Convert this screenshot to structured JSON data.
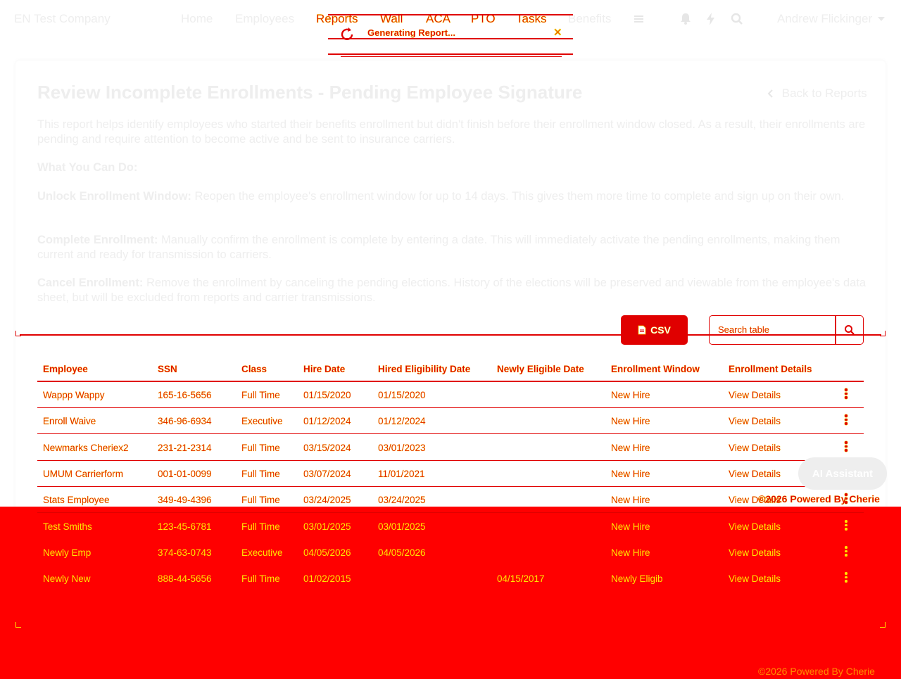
{
  "company": "EN Test Company",
  "nav": {
    "links": [
      "Home",
      "Employees",
      "Reports",
      "Wall",
      "ACA",
      "PTO",
      "Tasks",
      "Benefits"
    ],
    "menu_icon": "hamburger-icon",
    "bell_icon": "bell-icon",
    "bolt_icon": "bolt-icon",
    "search_icon": "search-icon",
    "user": "Andrew Flickinger"
  },
  "toast": {
    "message": "Generating Report...",
    "close": "✕"
  },
  "page": {
    "title": "Review Incomplete Enrollments - Pending Employee Signature",
    "back_link": "Back to Reports",
    "intro": "This report helps identify employees who started their benefits enrollment but didn't finish before their enrollment window closed. As a result, their enrollments are pending and require attention to become active and be sent to insurance carriers.",
    "what_you_can_do": "What You Can Do:",
    "unlock_title": "Unlock Enrollment Window:",
    "unlock_text": " Reopen the employee's enrollment window for up to 14 days. This gives them more time to complete and sign up on their own.",
    "complete_title": "Complete Enrollment:",
    "complete_text": " Manually confirm the enrollment is complete by entering a date. This will immediately activate the pending enrollments, making them current and ready for transmission to carriers.",
    "cancel_title": "Cancel Enrollment:",
    "cancel_text": " Remove the enrollment by canceling the pending elections. History of the elections will be preserved and viewable from the employee's data sheet, but will be excluded from reports and carrier transmissions."
  },
  "toolbar": {
    "csv_label": "CSV",
    "search_placeholder": "Search table"
  },
  "table": {
    "columns": [
      "Employee",
      "SSN",
      "Class",
      "Hire Date",
      "Hired Eligibility Date",
      "Newly Eligible Date",
      "Enrollment Window",
      "Enrollment Details"
    ],
    "rows": [
      [
        "Wappp Wappy",
        "165-16-5656",
        "Full Time",
        "01/15/2020",
        "01/15/2020",
        "",
        "New Hire",
        "View Details"
      ],
      [
        "Enroll Waive",
        "346-96-6934",
        "Executive",
        "01/12/2024",
        "01/12/2024",
        "",
        "New Hire",
        "View Details"
      ],
      [
        "Newmarks Cheriex2",
        "231-21-2314",
        "Full Time",
        "03/15/2024",
        "03/01/2023",
        "",
        "New Hire",
        "View Details"
      ],
      [
        "UMUM Carrierform",
        "001-01-0099",
        "Full Time",
        "03/07/2024",
        "11/01/2021",
        "",
        "New Hire",
        "View Details"
      ],
      [
        "Stats Employee",
        "349-49-4396",
        "Full Time",
        "03/24/2025",
        "03/24/2025",
        "",
        "New Hire",
        "View Details"
      ],
      [
        "Test Smiths",
        "123-45-6781",
        "Full Time",
        "03/01/2025",
        "03/01/2025",
        "",
        "New Hire",
        "View Details"
      ],
      [
        "Newly Emp",
        "374-63-0743",
        "Executive",
        "04/05/2026",
        "04/05/2026",
        "",
        "New Hire",
        "View Details"
      ],
      [
        "Newly New",
        "888-44-5656",
        "Full Time",
        "01/02/2015",
        "",
        "04/15/2017",
        "Newly Eligib",
        "View Details"
      ]
    ]
  },
  "assistant": {
    "label": "AI Assistant",
    "powered": "©2026 Powered By Cherie"
  },
  "colors": {
    "accent": "#e00000",
    "outline": "#f4d000",
    "band": "#ff0000"
  }
}
